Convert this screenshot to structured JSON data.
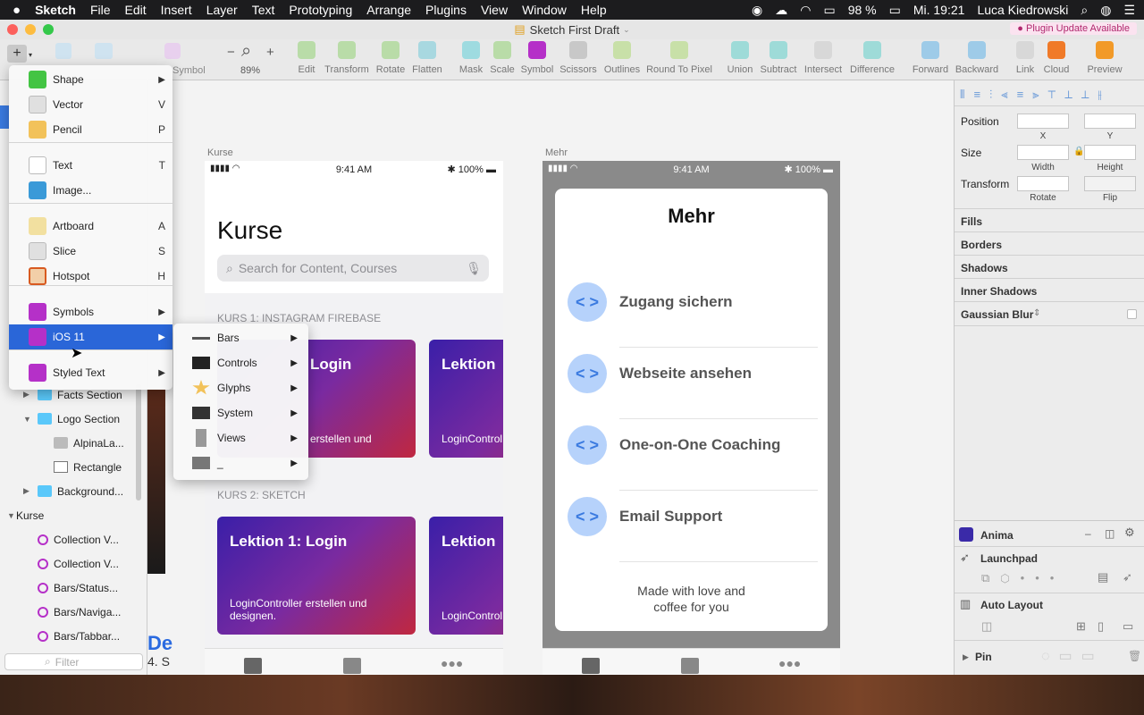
{
  "menubar": {
    "apple": "",
    "app": "Sketch",
    "items": [
      "File",
      "Edit",
      "Insert",
      "Layer",
      "Text",
      "Prototyping",
      "Arrange",
      "Plugins",
      "View",
      "Window",
      "Help"
    ],
    "battery": "98 %",
    "clock": "Mi. 19:21",
    "user": "Luca Kiedrowski"
  },
  "window": {
    "title": "Sketch First Draft",
    "plugin_badge": "Plugin Update Available"
  },
  "toolbar": {
    "zoom": "89%",
    "symbol_dim": "Symbol",
    "items": [
      {
        "label": "Edit",
        "color": "#b9dca8"
      },
      {
        "label": "Transform",
        "color": "#b9dca8"
      },
      {
        "label": "Rotate",
        "color": "#b9dca8"
      },
      {
        "label": "Flatten",
        "color": "#a8d8e0"
      },
      {
        "label": "Mask",
        "color": "#9edbe0"
      },
      {
        "label": "Scale",
        "color": "#b9dca8"
      },
      {
        "label": "Symbol",
        "color": "#b530c8"
      },
      {
        "label": "Scissors",
        "color": "#c8c8c8"
      },
      {
        "label": "Outlines",
        "color": "#c8e0a8"
      },
      {
        "label": "Round To Pixel",
        "color": "#c8e0a8"
      },
      {
        "label": "Union",
        "color": "#9edbd8"
      },
      {
        "label": "Subtract",
        "color": "#9edbd8"
      },
      {
        "label": "Intersect",
        "color": "#d8d8d8"
      },
      {
        "label": "Difference",
        "color": "#9edbd8"
      },
      {
        "label": "Forward",
        "color": "#9ecbe8"
      },
      {
        "label": "Backward",
        "color": "#9ecbe8"
      },
      {
        "label": "Link",
        "color": "#d8d8d8"
      },
      {
        "label": "Cloud",
        "color": "#f07a28"
      },
      {
        "label": "Preview",
        "color": "#f29a28"
      }
    ]
  },
  "layers": [
    {
      "name": "Facts Section",
      "indent": 1,
      "open": false,
      "icon": "folder-icon"
    },
    {
      "name": "Logo Section",
      "indent": 1,
      "open": true,
      "icon": "folder-icon"
    },
    {
      "name": "AlpinaLa...",
      "indent": 2,
      "icon": "image-icon"
    },
    {
      "name": "Rectangle",
      "indent": 2,
      "icon": "rectangle-icon"
    },
    {
      "name": "Background...",
      "indent": 1,
      "open": false,
      "icon": "folder-icon"
    },
    {
      "name": "Kurse",
      "indent": 0,
      "open": true,
      "icon": "none"
    },
    {
      "name": "Collection V...",
      "indent": 1,
      "icon": "symbol-icon"
    },
    {
      "name": "Collection V...",
      "indent": 1,
      "icon": "symbol-icon"
    },
    {
      "name": "Bars/Status...",
      "indent": 1,
      "icon": "symbol-icon"
    },
    {
      "name": "Bars/Naviga...",
      "indent": 1,
      "icon": "symbol-icon"
    },
    {
      "name": "Bars/Tabbar...",
      "indent": 1,
      "icon": "symbol-icon"
    }
  ],
  "filter_placeholder": "Filter",
  "insert_menu": {
    "items": [
      {
        "label": "Shape",
        "shortcut": "",
        "submenu": true,
        "icon": "shape-icon"
      },
      {
        "label": "Vector",
        "shortcut": "V",
        "icon": "vector-icon"
      },
      {
        "label": "Pencil",
        "shortcut": "P",
        "icon": "pencil-icon"
      },
      {
        "label": "Text",
        "shortcut": "T",
        "icon": "text-icon"
      },
      {
        "label": "Image...",
        "shortcut": "",
        "icon": "image-icon"
      },
      {
        "label": "Artboard",
        "shortcut": "A",
        "icon": "artboard-icon"
      },
      {
        "label": "Slice",
        "shortcut": "S",
        "icon": "slice-icon"
      },
      {
        "label": "Hotspot",
        "shortcut": "H",
        "icon": "hotspot-icon"
      },
      {
        "label": "Symbols",
        "shortcut": "",
        "submenu": true,
        "icon": "symbols-icon"
      },
      {
        "label": "iOS 11",
        "shortcut": "",
        "submenu": true,
        "icon": "ios-library-icon",
        "selected": true
      },
      {
        "label": "Styled Text",
        "shortcut": "",
        "submenu": true,
        "icon": "styled-text-icon"
      }
    ]
  },
  "ios_submenu": [
    {
      "label": "Bars",
      "icon": "bars-icon"
    },
    {
      "label": "Controls",
      "icon": "controls-icon"
    },
    {
      "label": "Glyphs",
      "icon": "glyphs-icon"
    },
    {
      "label": "System",
      "icon": "system-icon"
    },
    {
      "label": "Views",
      "icon": "views-icon"
    },
    {
      "label": "_",
      "icon": "placeholder-icon"
    }
  ],
  "artboard_kurse": {
    "label": "Kurse",
    "time": "9:41 AM",
    "battery": "100%",
    "title": "Kurse",
    "search_placeholder": "Search for Content, Courses",
    "section1": "KURS 1: INSTAGRAM FIREBASE",
    "section2": "KURS 2: SKETCH",
    "cards1": [
      {
        "title": "Login",
        "desc": "erstellen und"
      },
      {
        "title": "Lektion",
        "desc": "LoginControl designen."
      }
    ],
    "cards2": [
      {
        "title": "Lektion 1: Login",
        "desc": "LoginController erstellen und designen."
      },
      {
        "title": "Lektion",
        "desc": "LoginControl designen."
      }
    ]
  },
  "artboard_mehr": {
    "label": "Mehr",
    "time": "9:41 AM",
    "battery": "100%",
    "title": "Mehr",
    "items": [
      "Zugang sichern",
      "Webseite ansehen",
      "One-on-One Coaching",
      "Email Support"
    ],
    "footer": "Made with love and coffee for you",
    "chev": "< >"
  },
  "canvas_fragment": {
    "letters": "De",
    "sub": "4. S"
  },
  "inspector": {
    "position": "Position",
    "x": "X",
    "y": "Y",
    "size": "Size",
    "width": "Width",
    "height": "Height",
    "transform": "Transform",
    "rotate": "Rotate",
    "flip": "Flip",
    "sections": [
      "Fills",
      "Borders",
      "Shadows",
      "Inner Shadows",
      "Gaussian Blur"
    ],
    "plugins": [
      "Anima",
      "Launchpad",
      "Auto Layout",
      "Pin"
    ]
  }
}
